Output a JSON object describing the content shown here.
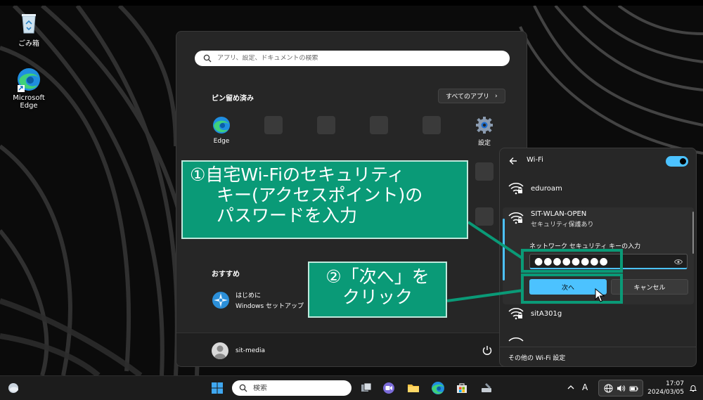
{
  "desktop": {
    "recycle_bin_label": "ごみ箱",
    "edge_label": "Microsoft Edge"
  },
  "start_menu": {
    "search_placeholder": "アプリ、設定、ドキュメントの検索",
    "pinned_title": "ピン留め済み",
    "all_apps_label": "すべてのアプリ",
    "pinned_apps": [
      {
        "label": "Edge",
        "icon": "edge-icon"
      },
      {
        "label": "設定",
        "icon": "gear-icon"
      }
    ],
    "recommended_title": "おすすめ",
    "recommended_item": {
      "title": "はじめに",
      "subtitle": "Windows セットアップ"
    },
    "user_name": "sit-media"
  },
  "wifi_panel": {
    "title": "Wi-Fi",
    "toggle_on": true,
    "networks": [
      {
        "name": "eduroam"
      },
      {
        "name": "SIT-WLAN-OPEN",
        "status": "セキュリティ保護あり"
      },
      {
        "name": "sitA301g"
      }
    ],
    "key_label": "ネットワーク セキュリティ キーの入力",
    "key_value": "●●●●●●●●",
    "next_label": "次へ",
    "cancel_label": "キャンセル",
    "more_settings": "その他の Wi-Fi 設定",
    "accent_color": "#4cc2ff"
  },
  "annotations": {
    "step1_line1": "①自宅Wi-Fiのセキュリティ",
    "step1_line2": "キー(アクセスポイント)の",
    "step1_line3": "パスワードを入力",
    "step2_line1": "②「次へ」を",
    "step2_line2": "クリック",
    "color": "#0a9a77"
  },
  "taskbar": {
    "search_placeholder": "検索",
    "ime_indicator": "A",
    "time": "17:07",
    "date": "2024/03/05"
  }
}
